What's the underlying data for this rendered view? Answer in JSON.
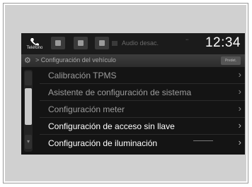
{
  "status_bar": {
    "phone_label": "Teléfono",
    "audio_label": "Audio desac.",
    "clock": "12:34"
  },
  "title_bar": {
    "path": "> Configuración del vehículo",
    "button_label": "Predet."
  },
  "menu": {
    "items": [
      {
        "label": "Calibración TPMS",
        "chevron": "›",
        "state": "dim"
      },
      {
        "label": "Asistente de configuración de sistema",
        "chevron": "›",
        "state": "dim"
      },
      {
        "label": "Configuración meter",
        "chevron": "›",
        "state": "dim"
      },
      {
        "label": "Configuración de acceso sin llave",
        "chevron": "›",
        "state": "bright"
      },
      {
        "label": "Configuración de iluminación",
        "chevron": "›",
        "state": "bright"
      }
    ]
  },
  "colors": {
    "screen_bg": "#141414",
    "bezel": "#d0d0d0",
    "text_bright": "#ffffff",
    "text_dim": "#9c9c9c"
  }
}
